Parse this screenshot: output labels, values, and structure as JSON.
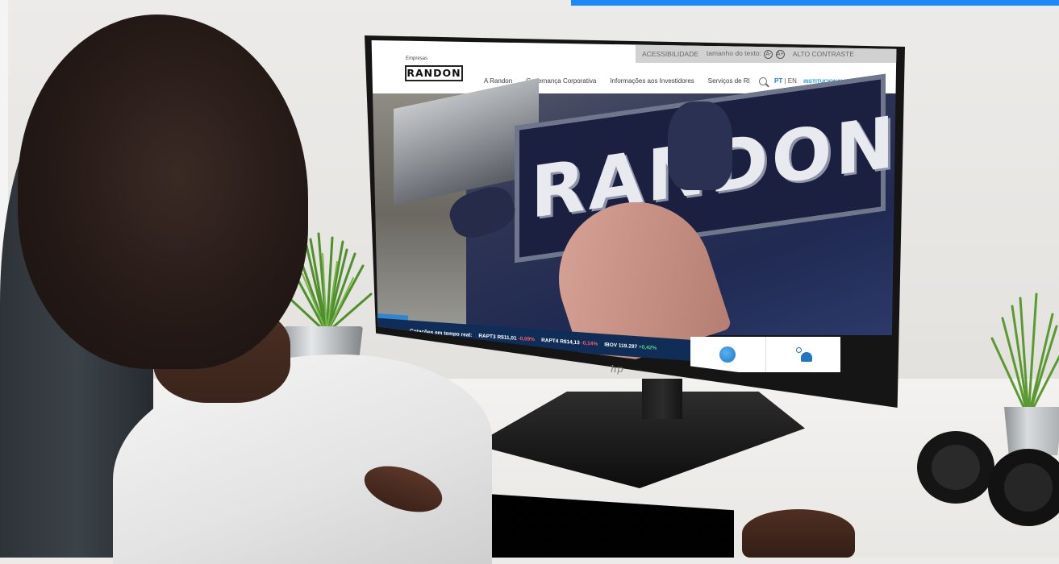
{
  "screen_site": {
    "accessibility_bar": {
      "accessibility_label": "ACESSIBILIDADE",
      "text_size_label": "tamanho do texto:",
      "decrease_text": "A-",
      "increase_text": "A+",
      "high_contrast_label": "ALTO CONTRASTE"
    },
    "logo": {
      "caption": "Empresas",
      "wordmark": "RANDON"
    },
    "nav": {
      "items": [
        "A Randon",
        "Governança Corporativa",
        "Informações aos Investidores",
        "Serviços de RI"
      ]
    },
    "lang": {
      "pt": "PT",
      "sep": "|",
      "en": "EN",
      "institutional": "INSTITUCIONAL"
    },
    "hero": {
      "sign_text": "RANDON"
    },
    "ticker": {
      "label": "Cotações em tempo real:",
      "quotes": [
        {
          "symbol": "RAPT3",
          "price": "R$11,01",
          "change": "-0,09%",
          "trend": "down"
        },
        {
          "symbol": "RAPT4",
          "price": "R$14,13",
          "change": "-0,14%",
          "trend": "down"
        },
        {
          "symbol": "IBOV",
          "price": "119.297",
          "change": "+0,42%",
          "trend": "up"
        }
      ]
    },
    "quick_actions": [
      {
        "icon": "globe-icon"
      },
      {
        "icon": "people-icon"
      }
    ]
  },
  "monitor_brand": "hp",
  "colors": {
    "top_accent": "#1e88ff",
    "brand_blue": "#1a7fc1",
    "ticker_bg": "#0f2d57"
  }
}
